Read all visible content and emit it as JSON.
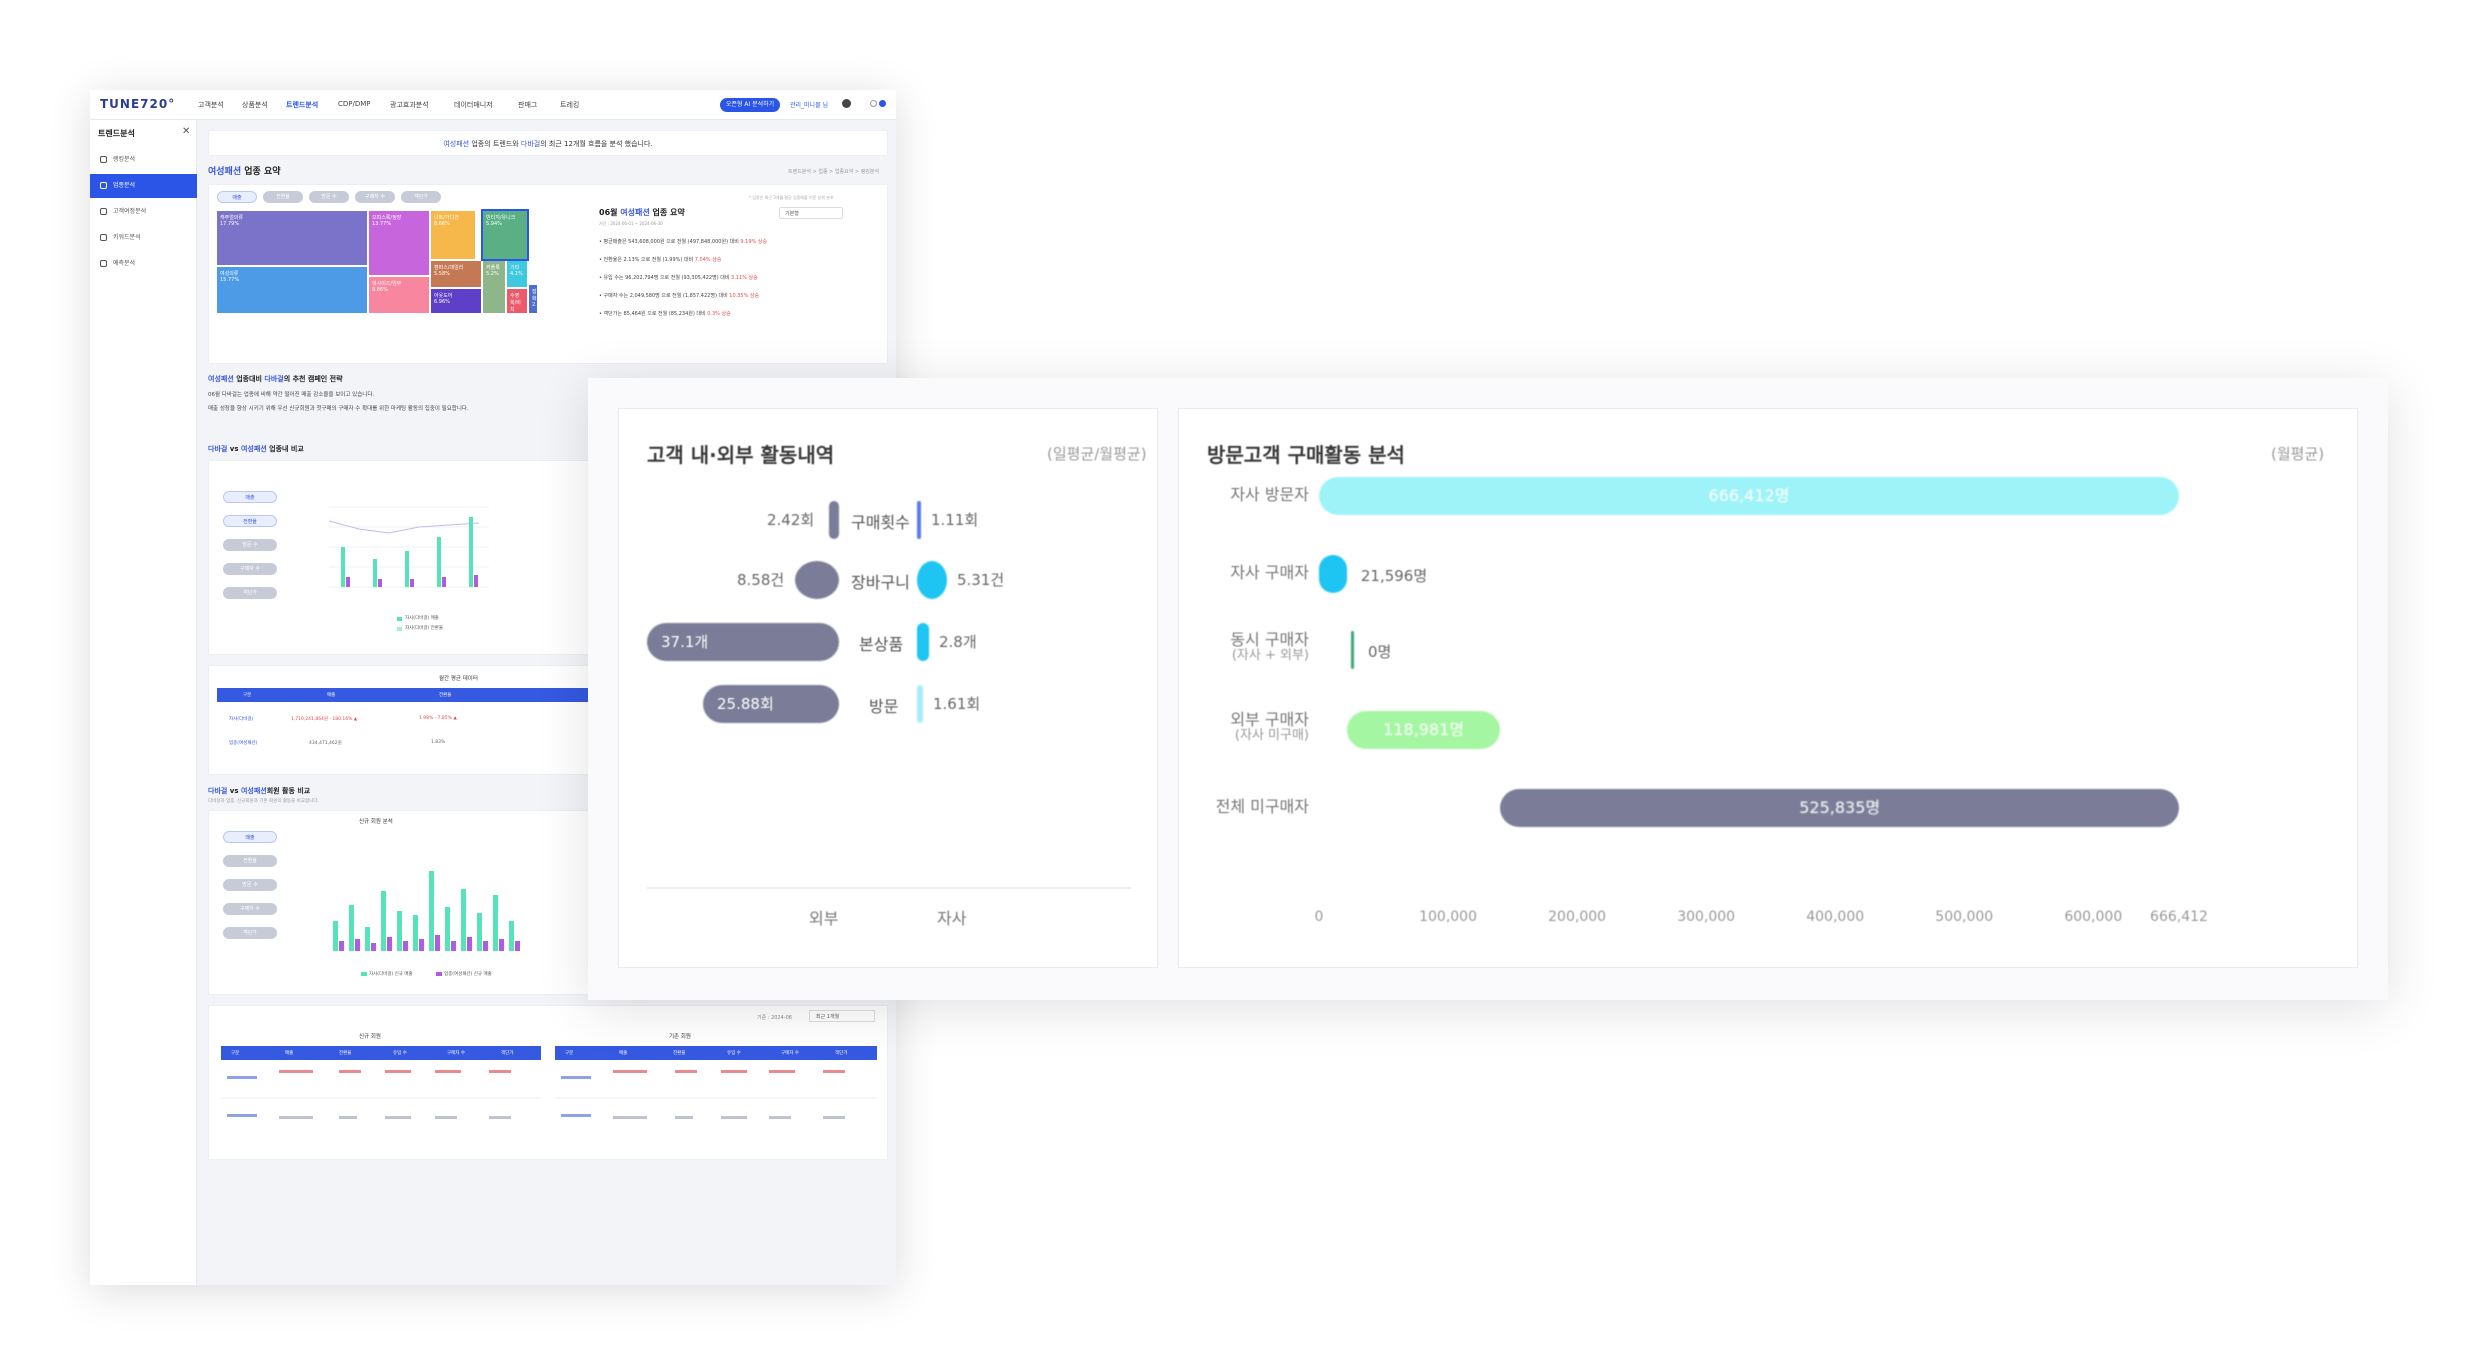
{
  "dashboard": {
    "logo": "TUNE720°",
    "nav": [
      "고객분석",
      "상품분석",
      "트렌드분석",
      "CDP/DMP",
      "광고효과분석",
      "데이터매니저",
      "판매그",
      "트레킹"
    ],
    "nav_active_index": 2,
    "ai_button": "오픈형 AI 분석하기",
    "user": "관리_미니몰 님",
    "sidebar": {
      "title": "트렌드분석",
      "items": [
        "랭킹분석",
        "업종분석",
        "고객여정분석",
        "키워드분석",
        "예측분석"
      ],
      "active_index": 1
    },
    "banner": {
      "pre": "",
      "industry": "여성패션",
      "mid": " 업종의 트렌드와 ",
      "brand": "다바걸",
      "post": "의 최근 12개월 흐름을 분석 했습니다."
    },
    "summary": {
      "industry": "여성패션",
      "title_suffix": " 업종 요약",
      "breadcrumb": "트렌드분석 > 업종 > 업종요약 > 랭킹분석",
      "filters": [
        "매출",
        "전환율",
        "방문 수",
        "구매자 수",
        "객단가"
      ],
      "note": "* 업종은 최근 3개월 평균 업종매출 기준 상위 분포",
      "treemap": [
        {
          "label": "캐주얼의류",
          "pct": "17.79%",
          "color": "#7b73c9"
        },
        {
          "label": "여성의류",
          "pct": "15.77%",
          "color": "#4d9be6"
        },
        {
          "label": "오피스룩/정장",
          "pct": "13.77%",
          "color": "#c766dc"
        },
        {
          "label": "빅사이즈/임부",
          "pct": "8.86%",
          "color": "#f7869e"
        },
        {
          "label": "니트/가디건",
          "pct": "8.66%",
          "color": "#f7b84b"
        },
        {
          "label": "캠퍼스/데일리",
          "pct": "5.58%",
          "color": "#c47853"
        },
        {
          "label": "아웃도어",
          "pct": "6.96%",
          "color": "#5f3fc7"
        },
        {
          "label": "빈티지/유니크",
          "pct": "5.94%",
          "color": "#5aaf85"
        },
        {
          "label": "커플룩",
          "pct": "5.2%",
          "color": "#8fb58b"
        },
        {
          "label": "기타",
          "pct": "4.1%",
          "color": "#3ec9e0"
        },
        {
          "label": "수영복/비치",
          "pct": "3.1%",
          "color": "#ec5a6c"
        },
        {
          "label": "잡화",
          "pct": "2.4%",
          "color": "#4d6ed0"
        }
      ],
      "month_title_prefix": "06월 ",
      "month_title_industry": "여성패션",
      "month_title_suffix": " 업종 요약",
      "month_sub": "기간 : 2024-06-01 ~ 2024-06-30",
      "month_select": "기본형",
      "bullets": [
        {
          "text": "평균매출은 543,608,000원 으로 전월 (497,848,000원) 대비 ",
          "delta": "9.19% 상승"
        },
        {
          "text": "전환율은 2.13% 으로 전월 (1.99%) 대비 ",
          "delta": "7.04% 상승"
        },
        {
          "text": "유입 수는 96,202,794명 으로 전월 (93,305,422명) 대비 ",
          "delta": "3.11% 상승"
        },
        {
          "text": "구매자 수는 2,049,580명 으로 전월 (1,857,422명) 대비 ",
          "delta": "10.35% 상승"
        },
        {
          "text": "객단가는 85,464원 으로 전월 (85,234원) 대비 ",
          "delta": "0.3% 상승"
        }
      ]
    },
    "strategy": {
      "industry": "여성패션",
      "mid": " 업종대비 ",
      "brand": "다바걸",
      "suffix": "의 추천 캠페인 전략",
      "lines": [
        "06월 다바걸는 업종에 비해 약간 떨어진 매출 감소율을 보이고 있습니다.",
        "매출 성장을 향상 시키기 위해 우선 신규회원과 첫구매의 구매자 수 확대를 위한 마케팅 활동의 집중이 필요합니다."
      ]
    },
    "compare": {
      "brand": "다바걸",
      "vs": " vs ",
      "industry": "여성패션",
      "suffix": " 업종내 비교",
      "chips": [
        "매출",
        "전환율",
        "방문 수",
        "구매자 수",
        "객단가"
      ],
      "legend": [
        "자사(다바걸) 매출",
        "자사(다바걸) 전환율"
      ]
    },
    "avg_table": {
      "title": "월간 평균 데이터",
      "headers": [
        "구분",
        "매출",
        "전환율"
      ],
      "rows": [
        [
          "자사(다바걸)",
          "1,710,241,864원 · 180.16% ▲",
          "1.98% · 7.85% ▲"
        ],
        [
          "업종(여성패션)",
          "434,471,462원",
          "1.83%"
        ]
      ]
    },
    "member": {
      "brand": "다바걸",
      "vs": " vs ",
      "industry": "여성패션",
      "suffix": "회원 활동 비교",
      "sub": "다바걸과 업종, 신규회원과 기존 회원의 활동을 비교합니다.",
      "chart_title": "신규 회원 분석",
      "chips": [
        "매출",
        "전환율",
        "방문 수",
        "구매자 수",
        "객단가"
      ],
      "legend_new": [
        "자사(다바걸) 신규 매출",
        "업종(여성패션) 신규 매출"
      ],
      "legend_old": [
        "자사(다바걸) 기존 매출",
        "업종(여성패션) 기존 매출"
      ]
    },
    "bottom": {
      "date_label": "기준 : 2024-06",
      "select": "최근 1개월",
      "new_title": "신규 회원",
      "old_title": "기존 회원",
      "headers": [
        "구분",
        "매출",
        "전환율",
        "유입 수",
        "구매자 수",
        "객단가"
      ]
    }
  },
  "activity_panel": {
    "title": "고객 내·외부 활동내역",
    "unit": "(일평균/월평균)",
    "rows": [
      {
        "label": "구매횟수",
        "external": "2.42회",
        "internal": "1.11회"
      },
      {
        "label": "장바구니",
        "external": "8.58건",
        "internal": "5.31건"
      },
      {
        "label": "본상품",
        "external": "37.1개",
        "internal": "2.8개"
      },
      {
        "label": "방문",
        "external": "25.88회",
        "internal": "1.61회"
      }
    ],
    "x_labels": {
      "external": "외부",
      "internal": "자사"
    },
    "colors": {
      "external": "#7b7d98",
      "internal": "#1ec4f2"
    }
  },
  "purchase_panel": {
    "title": "방문고객 구매활동 분석",
    "unit": "(월평균)",
    "axis_ticks": [
      "0",
      "100,000",
      "200,000",
      "300,000",
      "400,000",
      "500,000",
      "600,000",
      "666,412"
    ],
    "rows": [
      {
        "label": "자사 방문자",
        "sub": "",
        "value_text": "666,412명",
        "color": "#9ef3f8"
      },
      {
        "label": "자사 구매자",
        "sub": "",
        "value_text": "21,596명",
        "color": "#1ec4f2"
      },
      {
        "label": "동시 구매자",
        "sub": "(자사 + 외부)",
        "value_text": "0명",
        "color": "#3ba57a"
      },
      {
        "label": "외부 구매자",
        "sub": "(자사 미구매)",
        "value_text": "118,981명",
        "color": "#a5f6a2"
      },
      {
        "label": "전체 미구매자",
        "sub": "",
        "value_text": "525,835명",
        "color": "#7b7d98"
      }
    ],
    "chart_data": {
      "type": "bar",
      "orientation": "horizontal",
      "categories": [
        "자사 방문자",
        "자사 구매자",
        "동시 구매자",
        "외부 구매자",
        "전체 미구매자"
      ],
      "ranges": [
        [
          0,
          666412
        ],
        [
          0,
          21596
        ],
        [
          0,
          0
        ],
        [
          21596,
          140577
        ],
        [
          140577,
          666412
        ]
      ],
      "values": [
        666412,
        21596,
        0,
        118981,
        525835
      ],
      "xlim": [
        0,
        666412
      ],
      "unit": "명"
    }
  }
}
